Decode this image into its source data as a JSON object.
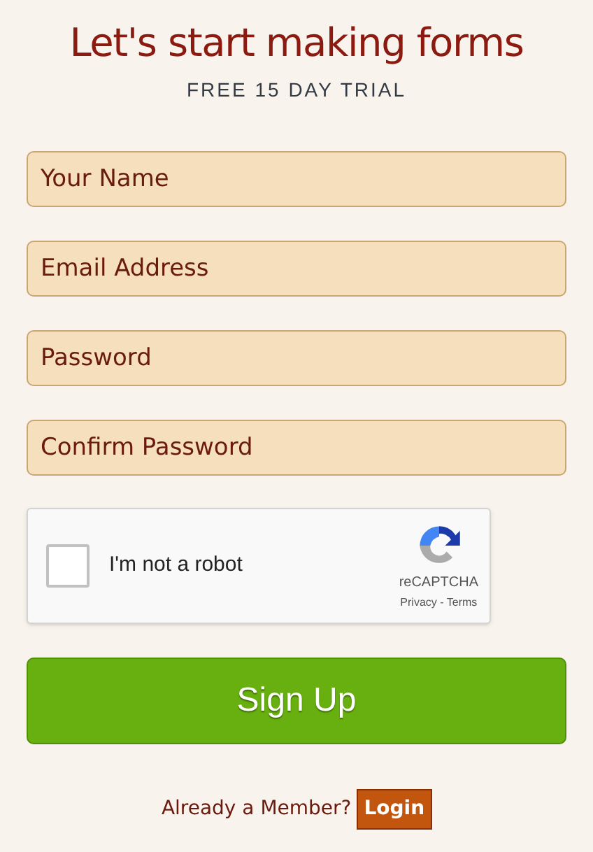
{
  "heading": "Let's start making forms",
  "subheading": "FREE 15 DAY TRIAL",
  "fields": [
    {
      "placeholder": "Your Name"
    },
    {
      "placeholder": "Email Address"
    },
    {
      "placeholder": "Password"
    },
    {
      "placeholder": "Confirm Password"
    }
  ],
  "captcha": {
    "label": "I'm not a robot",
    "checked": false,
    "brand": "reCAPTCHA",
    "links": "Privacy - Terms"
  },
  "submit_button": "Sign Up",
  "footer": {
    "text": "Already a Member?",
    "link": "Login"
  }
}
